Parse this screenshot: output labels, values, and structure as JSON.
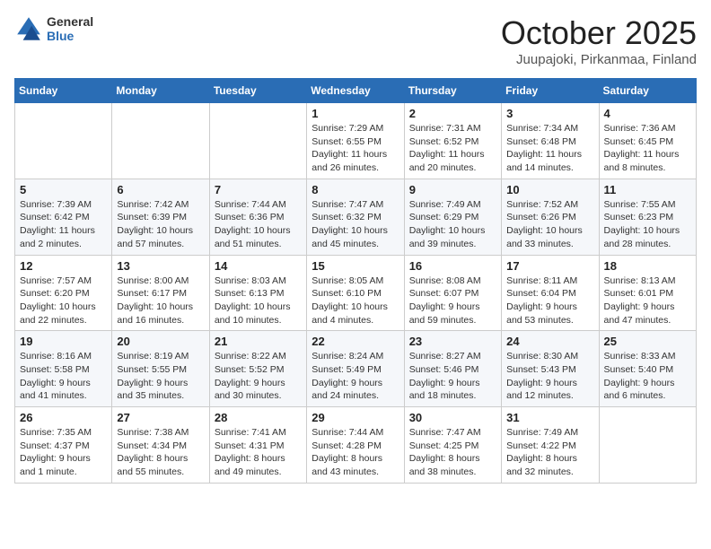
{
  "header": {
    "logo_general": "General",
    "logo_blue": "Blue",
    "month": "October 2025",
    "location": "Juupajoki, Pirkanmaa, Finland"
  },
  "days_of_week": [
    "Sunday",
    "Monday",
    "Tuesday",
    "Wednesday",
    "Thursday",
    "Friday",
    "Saturday"
  ],
  "weeks": [
    [
      {
        "day": "",
        "info": ""
      },
      {
        "day": "",
        "info": ""
      },
      {
        "day": "",
        "info": ""
      },
      {
        "day": "1",
        "info": "Sunrise: 7:29 AM\nSunset: 6:55 PM\nDaylight: 11 hours\nand 26 minutes."
      },
      {
        "day": "2",
        "info": "Sunrise: 7:31 AM\nSunset: 6:52 PM\nDaylight: 11 hours\nand 20 minutes."
      },
      {
        "day": "3",
        "info": "Sunrise: 7:34 AM\nSunset: 6:48 PM\nDaylight: 11 hours\nand 14 minutes."
      },
      {
        "day": "4",
        "info": "Sunrise: 7:36 AM\nSunset: 6:45 PM\nDaylight: 11 hours\nand 8 minutes."
      }
    ],
    [
      {
        "day": "5",
        "info": "Sunrise: 7:39 AM\nSunset: 6:42 PM\nDaylight: 11 hours\nand 2 minutes."
      },
      {
        "day": "6",
        "info": "Sunrise: 7:42 AM\nSunset: 6:39 PM\nDaylight: 10 hours\nand 57 minutes."
      },
      {
        "day": "7",
        "info": "Sunrise: 7:44 AM\nSunset: 6:36 PM\nDaylight: 10 hours\nand 51 minutes."
      },
      {
        "day": "8",
        "info": "Sunrise: 7:47 AM\nSunset: 6:32 PM\nDaylight: 10 hours\nand 45 minutes."
      },
      {
        "day": "9",
        "info": "Sunrise: 7:49 AM\nSunset: 6:29 PM\nDaylight: 10 hours\nand 39 minutes."
      },
      {
        "day": "10",
        "info": "Sunrise: 7:52 AM\nSunset: 6:26 PM\nDaylight: 10 hours\nand 33 minutes."
      },
      {
        "day": "11",
        "info": "Sunrise: 7:55 AM\nSunset: 6:23 PM\nDaylight: 10 hours\nand 28 minutes."
      }
    ],
    [
      {
        "day": "12",
        "info": "Sunrise: 7:57 AM\nSunset: 6:20 PM\nDaylight: 10 hours\nand 22 minutes."
      },
      {
        "day": "13",
        "info": "Sunrise: 8:00 AM\nSunset: 6:17 PM\nDaylight: 10 hours\nand 16 minutes."
      },
      {
        "day": "14",
        "info": "Sunrise: 8:03 AM\nSunset: 6:13 PM\nDaylight: 10 hours\nand 10 minutes."
      },
      {
        "day": "15",
        "info": "Sunrise: 8:05 AM\nSunset: 6:10 PM\nDaylight: 10 hours\nand 4 minutes."
      },
      {
        "day": "16",
        "info": "Sunrise: 8:08 AM\nSunset: 6:07 PM\nDaylight: 9 hours\nand 59 minutes."
      },
      {
        "day": "17",
        "info": "Sunrise: 8:11 AM\nSunset: 6:04 PM\nDaylight: 9 hours\nand 53 minutes."
      },
      {
        "day": "18",
        "info": "Sunrise: 8:13 AM\nSunset: 6:01 PM\nDaylight: 9 hours\nand 47 minutes."
      }
    ],
    [
      {
        "day": "19",
        "info": "Sunrise: 8:16 AM\nSunset: 5:58 PM\nDaylight: 9 hours\nand 41 minutes."
      },
      {
        "day": "20",
        "info": "Sunrise: 8:19 AM\nSunset: 5:55 PM\nDaylight: 9 hours\nand 35 minutes."
      },
      {
        "day": "21",
        "info": "Sunrise: 8:22 AM\nSunset: 5:52 PM\nDaylight: 9 hours\nand 30 minutes."
      },
      {
        "day": "22",
        "info": "Sunrise: 8:24 AM\nSunset: 5:49 PM\nDaylight: 9 hours\nand 24 minutes."
      },
      {
        "day": "23",
        "info": "Sunrise: 8:27 AM\nSunset: 5:46 PM\nDaylight: 9 hours\nand 18 minutes."
      },
      {
        "day": "24",
        "info": "Sunrise: 8:30 AM\nSunset: 5:43 PM\nDaylight: 9 hours\nand 12 minutes."
      },
      {
        "day": "25",
        "info": "Sunrise: 8:33 AM\nSunset: 5:40 PM\nDaylight: 9 hours\nand 6 minutes."
      }
    ],
    [
      {
        "day": "26",
        "info": "Sunrise: 7:35 AM\nSunset: 4:37 PM\nDaylight: 9 hours\nand 1 minute."
      },
      {
        "day": "27",
        "info": "Sunrise: 7:38 AM\nSunset: 4:34 PM\nDaylight: 8 hours\nand 55 minutes."
      },
      {
        "day": "28",
        "info": "Sunrise: 7:41 AM\nSunset: 4:31 PM\nDaylight: 8 hours\nand 49 minutes."
      },
      {
        "day": "29",
        "info": "Sunrise: 7:44 AM\nSunset: 4:28 PM\nDaylight: 8 hours\nand 43 minutes."
      },
      {
        "day": "30",
        "info": "Sunrise: 7:47 AM\nSunset: 4:25 PM\nDaylight: 8 hours\nand 38 minutes."
      },
      {
        "day": "31",
        "info": "Sunrise: 7:49 AM\nSunset: 4:22 PM\nDaylight: 8 hours\nand 32 minutes."
      },
      {
        "day": "",
        "info": ""
      }
    ]
  ]
}
